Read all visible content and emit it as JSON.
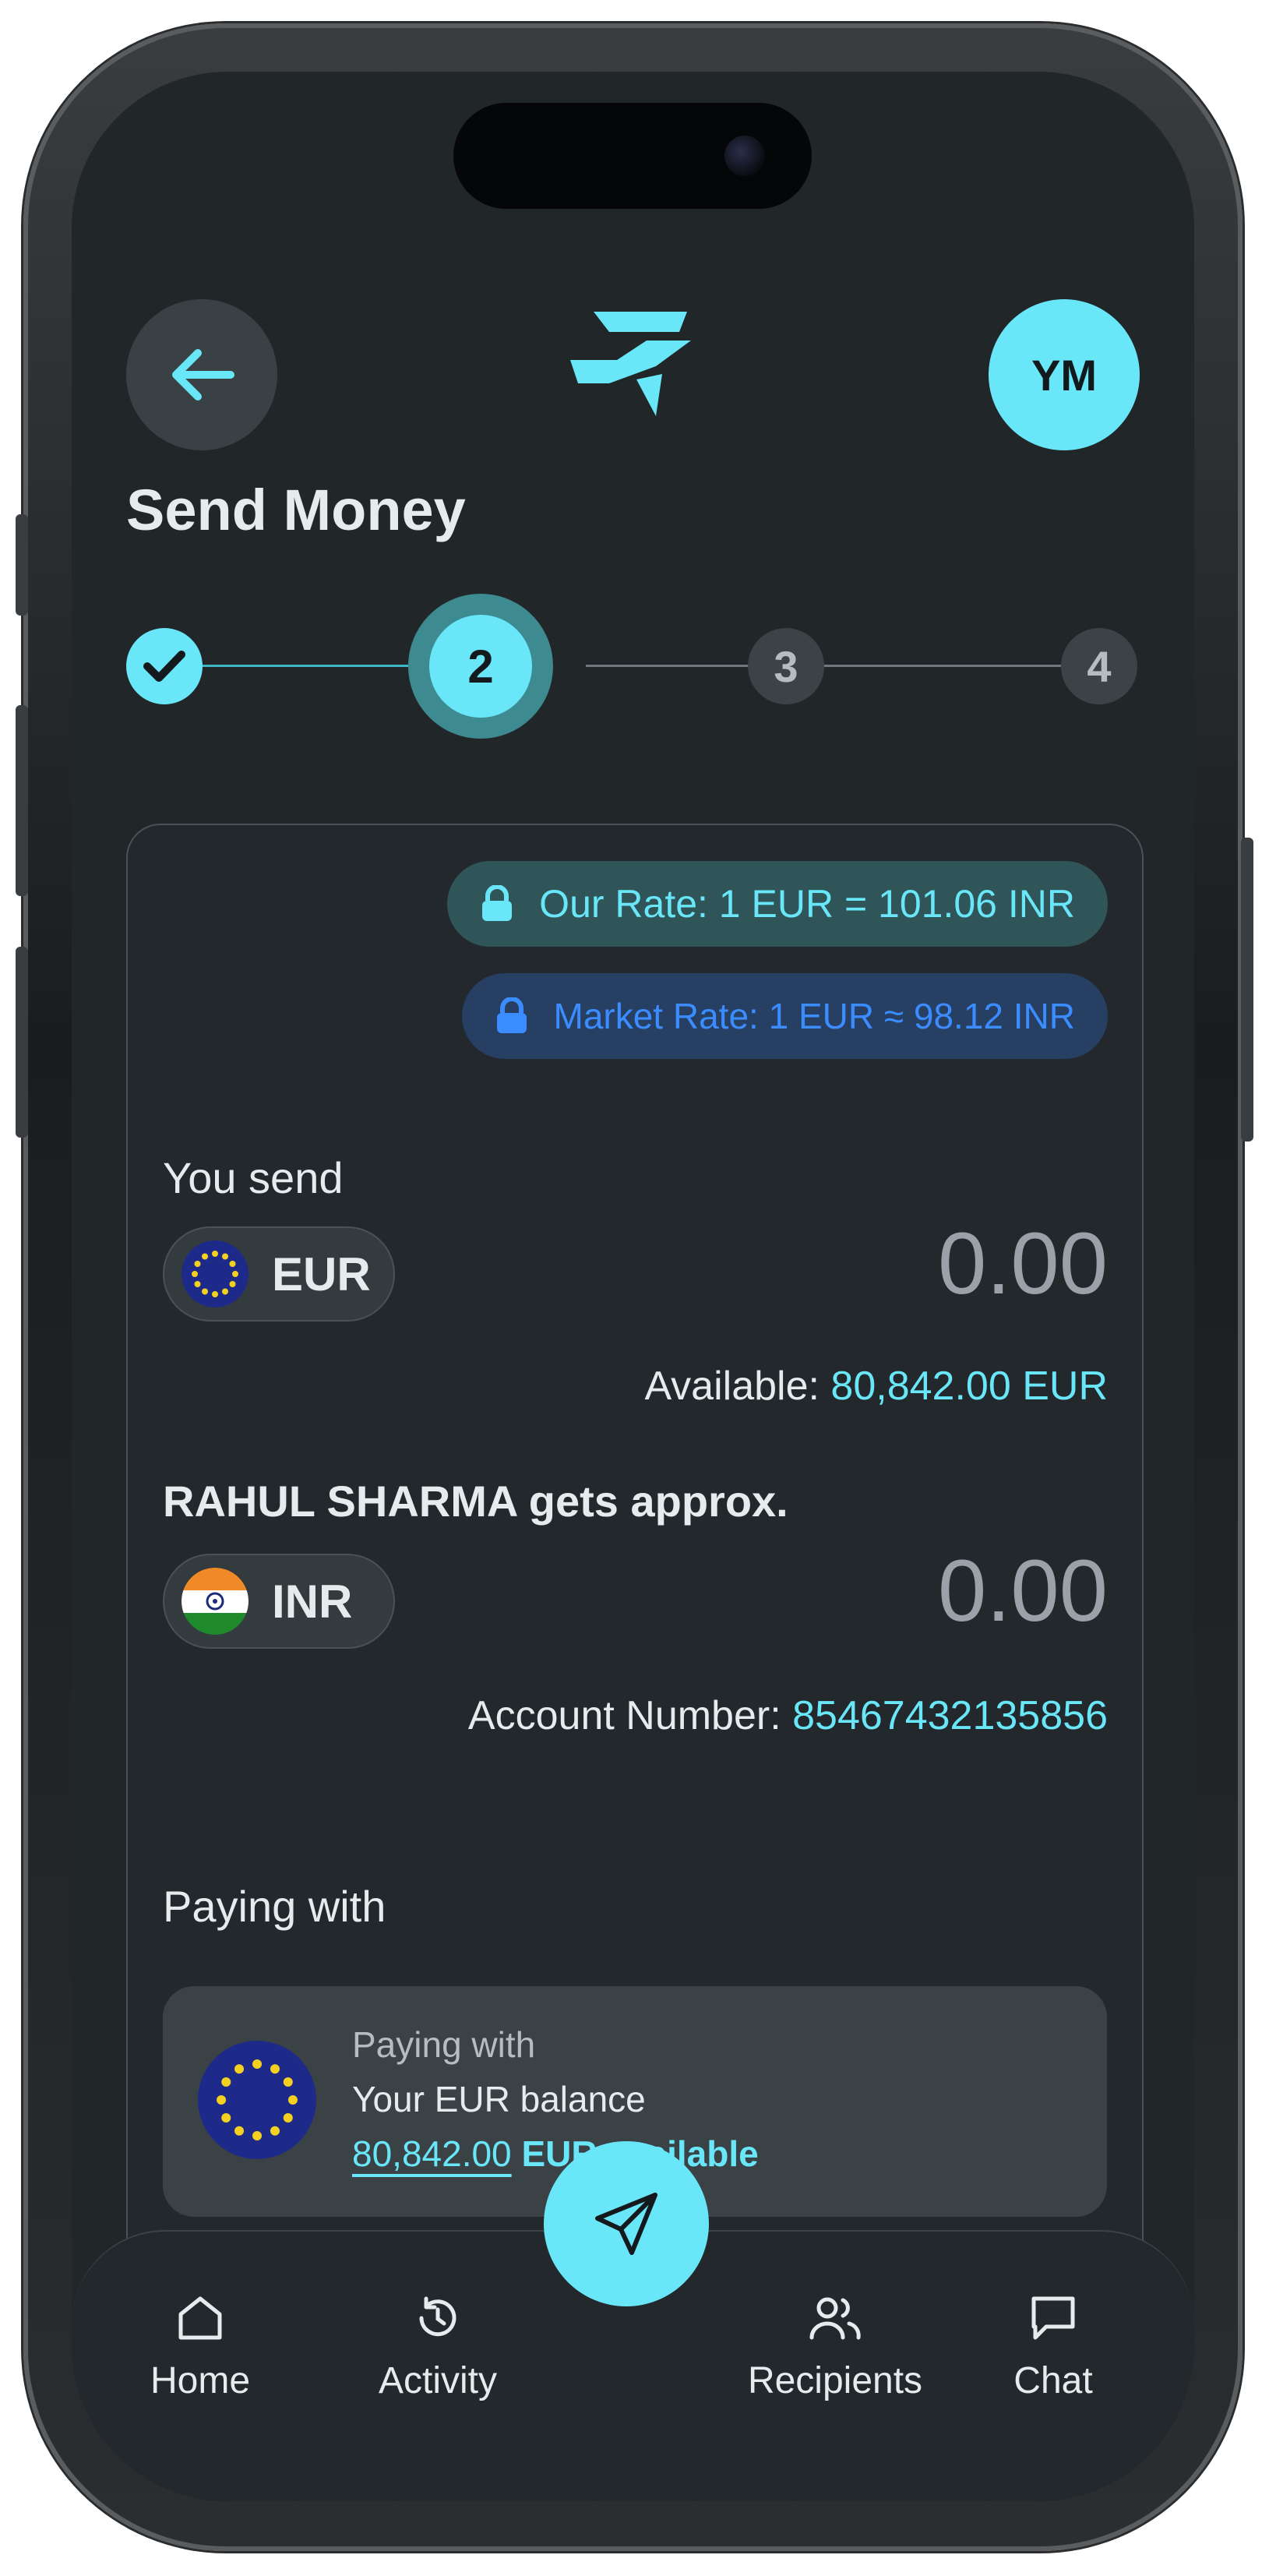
{
  "header": {
    "avatar_initials": "YM",
    "title": "Send Money"
  },
  "stepper": {
    "steps": [
      "2",
      "3",
      "4"
    ],
    "current_step": 2,
    "completed_steps": 1
  },
  "rates": {
    "our_rate": "Our Rate: 1 EUR = 101.06 INR",
    "market_rate": "Market Rate: 1 EUR ≈ 98.12 INR"
  },
  "send": {
    "label": "You send",
    "currency": "EUR",
    "amount": "0.00",
    "available_label": "Available:",
    "available_value": "80,842.00 EUR"
  },
  "receive": {
    "label": "RAHUL SHARMA gets approx.",
    "currency": "INR",
    "amount": "0.00",
    "account_label": "Account Number:",
    "account_value": "85467432135856"
  },
  "paying": {
    "section_label": "Paying with",
    "box_label": "Paying with",
    "source": "Your EUR balance",
    "amount": "80,842.00",
    "suffix": "EUR available"
  },
  "nav": {
    "items": [
      "Home",
      "Activity",
      "Recipients",
      "Chat"
    ]
  },
  "colors": {
    "accent": "#69e6f7",
    "background": "#212629",
    "market_rate_blue": "#3b8cff"
  }
}
